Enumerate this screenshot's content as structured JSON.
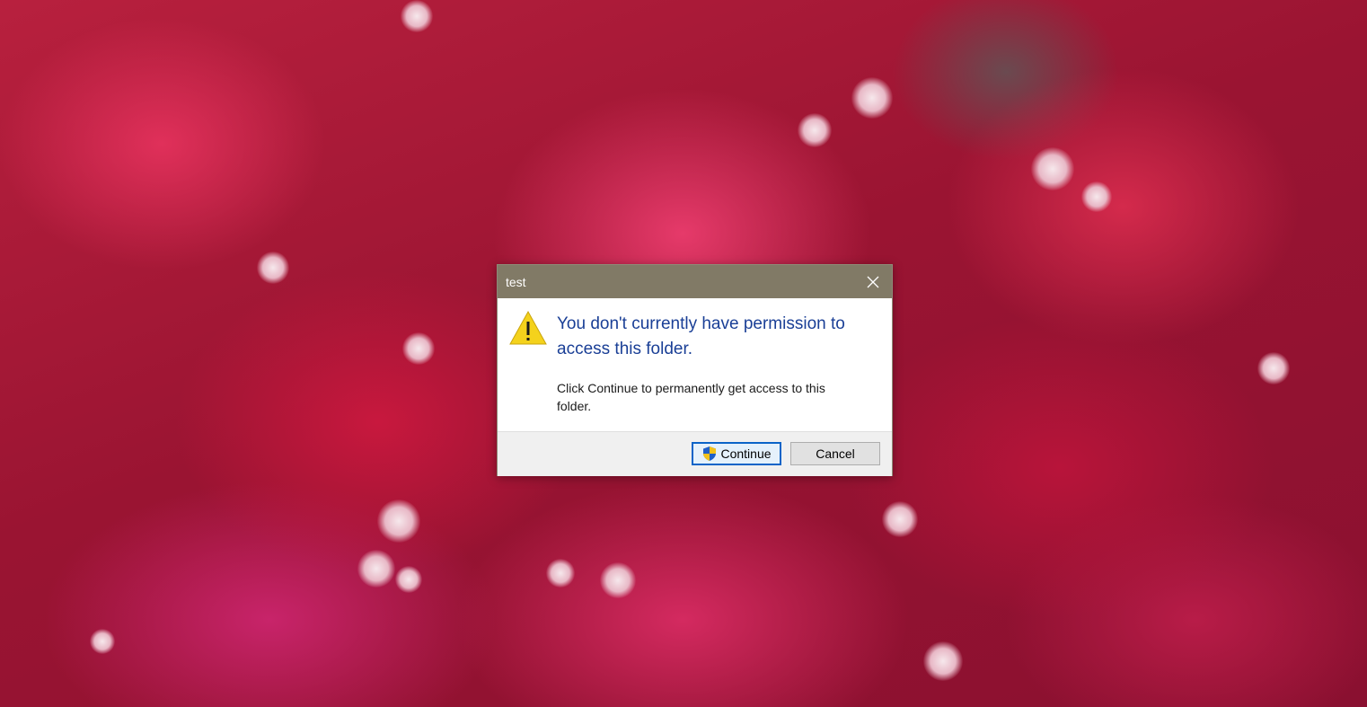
{
  "dialog": {
    "title": "test",
    "heading": "You don't currently have permission to access this folder.",
    "message": "Click Continue to permanently get access to this folder.",
    "buttons": {
      "continue_label": "Continue",
      "cancel_label": "Cancel"
    },
    "icons": {
      "main": "warning-icon",
      "continue": "uac-shield-icon",
      "close": "close-icon"
    }
  },
  "colors": {
    "titlebar": "#817a66",
    "heading_text": "#1a3f96",
    "default_button_border": "#0a64c8",
    "footer": "#f0f0f0"
  }
}
